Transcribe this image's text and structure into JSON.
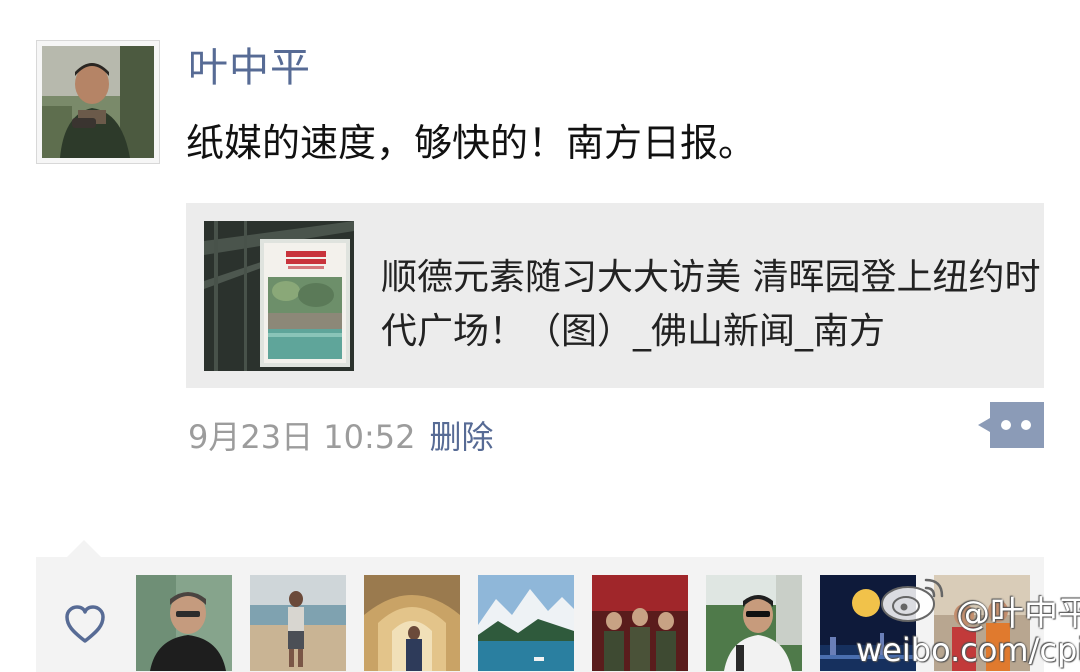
{
  "post": {
    "author": "叶中平",
    "text": "纸媒的速度，够快的！南方日报。",
    "link_card": {
      "title": "顺德元素随习大大访美 清晖园登上纽约时代广场！（图）_佛山新闻_南方"
    },
    "timestamp": "9月23日 10:52",
    "delete_label": "删除"
  },
  "icons": {
    "comment": "comment-more-icon",
    "like": "heart-icon",
    "watermark_logo": "weibo-logo-icon"
  },
  "colors": {
    "name_blue": "#576b95",
    "meta_gray": "#9c9c9c",
    "card_bg": "#ececec",
    "likes_bg": "#f3f3f3"
  },
  "watermark": {
    "handle": "@叶中平",
    "url": "weibo.com/cpip"
  }
}
